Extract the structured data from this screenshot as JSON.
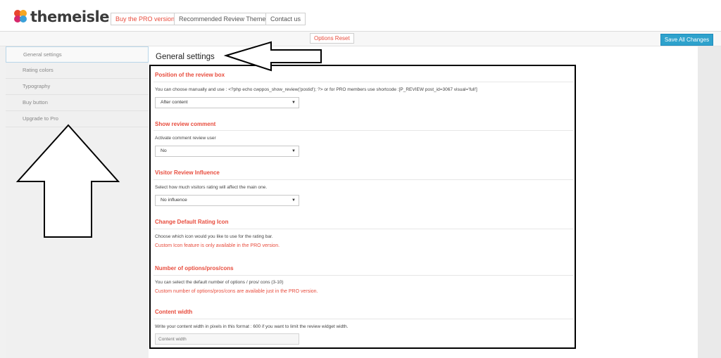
{
  "header": {
    "logo_text": "themeisle",
    "buttons": [
      "Buy the PRO version",
      "Recommended Review Themes",
      "Contact us"
    ]
  },
  "toolbar": {
    "reset_label": "Options Reset",
    "save_label": "Save All Changes"
  },
  "sidebar": {
    "items": [
      {
        "label": "General settings"
      },
      {
        "label": "Rating colors"
      },
      {
        "label": "Typography"
      },
      {
        "label": "Buy button"
      },
      {
        "label": "Upgrade to Pro"
      }
    ]
  },
  "main": {
    "title": "General settings",
    "sections": {
      "position": {
        "title": "Position of the review box",
        "desc": "You can choose manually and use : <?php echo cwppos_show_review('postid'); ?> or for PRO members use shortcode :[P_REVIEW post_id=3067 visual='full']",
        "value": "After content"
      },
      "comment": {
        "title": "Show review comment",
        "desc": "Activate comment review user",
        "value": "No"
      },
      "visitor": {
        "title": "Visitor Review Influence",
        "desc": "Select how much visitors rating will affect the main one.",
        "value": "No influence"
      },
      "icon": {
        "title": "Change Default Rating Icon",
        "desc": "Choose which icon would you like to use for the rating bar.",
        "warn": "Custom Icon feature is only available in the PRO version."
      },
      "options": {
        "title": "Number of options/pros/cons",
        "desc": "You can select the default number of options / pros/ cons (3-10)",
        "warn": "Custom number of options/pros/cons are available just in the PRO version."
      },
      "width": {
        "title": "Content width",
        "desc": "Write your content width in pixels in this format : 600 if you want to limit the review widget width.",
        "placeholder": "Content width"
      }
    }
  },
  "colors": {
    "accent": "#e84c3d",
    "save_button": "#2ea2cc"
  },
  "icons": [
    "logo-icon",
    "dropdown-caret-icon",
    "arrow-left-annotation",
    "arrow-up-annotation"
  ]
}
